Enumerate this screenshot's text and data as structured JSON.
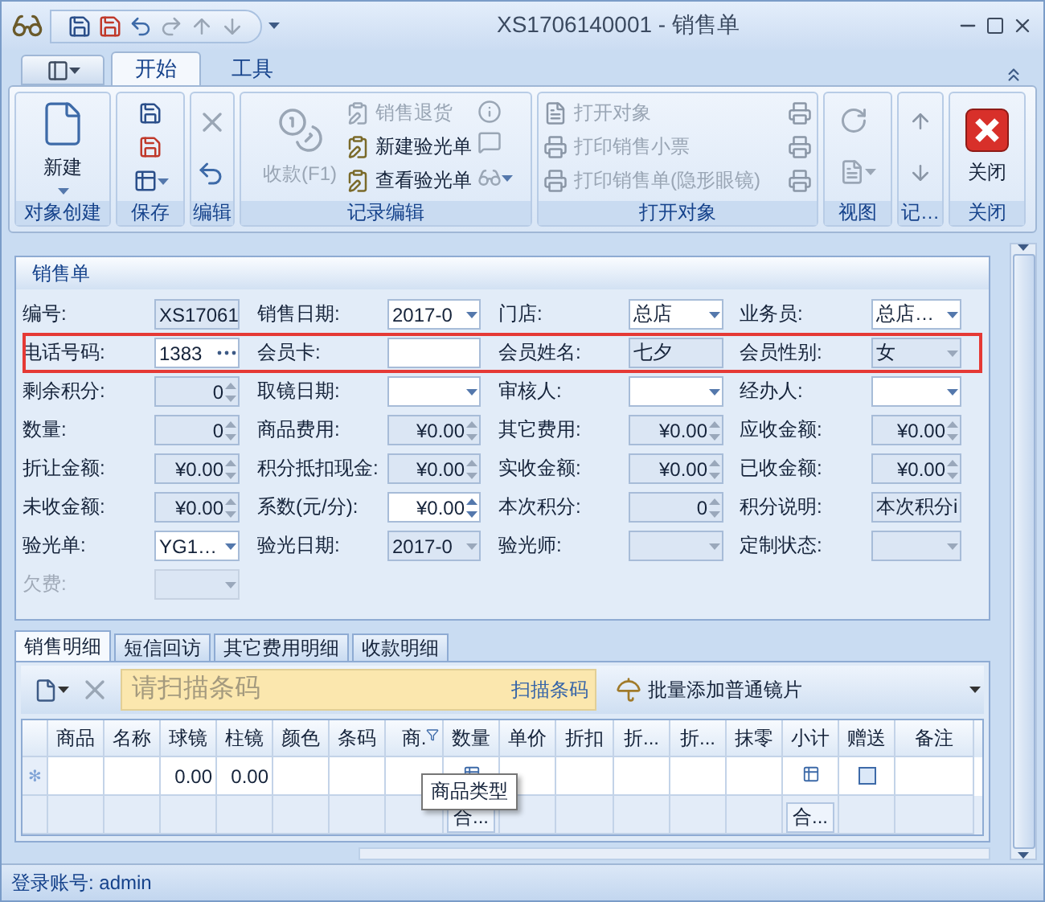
{
  "window": {
    "title": "XS1706140001 - 销售单"
  },
  "ribbon": {
    "tabs": [
      {
        "label": "开始",
        "selected": true
      },
      {
        "label": "工具",
        "selected": false
      }
    ],
    "groups": [
      {
        "title": "对象创建",
        "kind": "new",
        "buttons": [
          {
            "label": "新建",
            "disabled": false
          }
        ]
      },
      {
        "title": "保存",
        "kind": "save"
      },
      {
        "title": "编辑",
        "kind": "edit"
      },
      {
        "title": "记录编辑",
        "kind": "record",
        "buttons": [
          {
            "label": "收款(F1)",
            "disabled": true
          },
          {
            "label": "销售退货",
            "disabled": true
          },
          {
            "label": "新建验光单",
            "disabled": false
          },
          {
            "label": "查看验光单",
            "disabled": false
          }
        ]
      },
      {
        "title": "打开对象",
        "kind": "open",
        "buttons": [
          {
            "label": "打开对象",
            "disabled": true
          },
          {
            "label": "打印销售小票",
            "disabled": true
          },
          {
            "label": "打印销售单(隐形眼镜)",
            "disabled": true
          }
        ]
      },
      {
        "title": "视图",
        "kind": "view"
      },
      {
        "title": "记…",
        "kind": "nav"
      },
      {
        "title": "关闭",
        "kind": "close",
        "buttons": [
          {
            "label": "关闭",
            "disabled": false
          }
        ]
      }
    ]
  },
  "form": {
    "title": "销售单",
    "rows": [
      {
        "highlighted": false,
        "fields": [
          {
            "label": "编号:",
            "value": "XS17061",
            "kind": "text",
            "editable": false,
            "disabled": false
          },
          {
            "label": "销售日期:",
            "value": "2017-0",
            "kind": "combo",
            "editable": true,
            "disabled": false
          },
          {
            "label": "门店:",
            "value": "总店",
            "kind": "combo",
            "editable": true,
            "disabled": false
          },
          {
            "label": "业务员:",
            "value": "总店…",
            "kind": "combo",
            "editable": true,
            "disabled": false
          }
        ]
      },
      {
        "highlighted": true,
        "fields": [
          {
            "label": "电话号码:",
            "value": "1383",
            "kind": "ellipsis",
            "editable": true,
            "disabled": false
          },
          {
            "label": "会员卡:",
            "kind": "text",
            "editable": true,
            "disabled": false
          },
          {
            "label": "会员姓名:",
            "value": "七夕",
            "kind": "text",
            "editable": false,
            "disabled": false
          },
          {
            "label": "会员性别:",
            "value": "女",
            "kind": "combo",
            "editable": false,
            "disabled": false
          }
        ]
      },
      {
        "highlighted": false,
        "fields": [
          {
            "label": "剩余积分:",
            "value": "0",
            "kind": "spin",
            "editable": false,
            "disabled": false
          },
          {
            "label": "取镜日期:",
            "kind": "combo",
            "editable": true,
            "disabled": false
          },
          {
            "label": "审核人:",
            "kind": "combo",
            "editable": true,
            "disabled": false
          },
          {
            "label": "经办人:",
            "kind": "combo",
            "editable": true,
            "disabled": false
          }
        ]
      },
      {
        "highlighted": false,
        "fields": [
          {
            "label": "数量:",
            "value": "0",
            "kind": "spin",
            "editable": false,
            "disabled": false
          },
          {
            "label": "商品费用:",
            "value": "¥0.00",
            "kind": "spin",
            "editable": false,
            "disabled": false
          },
          {
            "label": "其它费用:",
            "value": "¥0.00",
            "kind": "spin",
            "editable": false,
            "disabled": false
          },
          {
            "label": "应收金额:",
            "value": "¥0.00",
            "kind": "spin",
            "editable": false,
            "disabled": false
          }
        ]
      },
      {
        "highlighted": false,
        "fields": [
          {
            "label": "折让金额:",
            "value": "¥0.00",
            "kind": "spin",
            "editable": false,
            "disabled": false
          },
          {
            "label": "积分抵扣现金:",
            "value": "¥0.00",
            "kind": "spin",
            "editable": false,
            "disabled": false
          },
          {
            "label": "实收金额:",
            "value": "¥0.00",
            "kind": "spin",
            "editable": false,
            "disabled": false
          },
          {
            "label": "已收金额:",
            "value": "¥0.00",
            "kind": "spin",
            "editable": false,
            "disabled": false
          }
        ]
      },
      {
        "highlighted": false,
        "fields": [
          {
            "label": "未收金额:",
            "value": "¥0.00",
            "kind": "spin",
            "editable": false,
            "disabled": false
          },
          {
            "label": "系数(元/分):",
            "value": "¥0.00",
            "kind": "spin",
            "editable": true,
            "disabled": false
          },
          {
            "label": "本次积分:",
            "value": "0",
            "kind": "spin",
            "editable": false,
            "disabled": false
          },
          {
            "label": "积分说明:",
            "value": "本次积分i",
            "kind": "text",
            "editable": false,
            "disabled": false
          }
        ]
      },
      {
        "highlighted": false,
        "fields": [
          {
            "label": "验光单:",
            "value": "YG1…",
            "kind": "combo",
            "editable": true,
            "disabled": false
          },
          {
            "label": "验光日期:",
            "value": "2017-0",
            "kind": "combo",
            "editable": false,
            "disabled": false
          },
          {
            "label": "验光师:",
            "kind": "combo",
            "editable": false,
            "disabled": false
          },
          {
            "label": "定制状态:",
            "kind": "combo",
            "editable": false,
            "disabled": false
          }
        ]
      },
      {
        "highlighted": false,
        "fields": [
          {
            "label": "欠费:",
            "kind": "combo",
            "editable": false,
            "disabled": true
          }
        ]
      }
    ]
  },
  "detail": {
    "tabs": [
      {
        "label": "销售明细",
        "selected": true
      },
      {
        "label": "短信回访",
        "selected": false
      },
      {
        "label": "其它费用明细",
        "selected": false
      },
      {
        "label": "收款明细",
        "selected": false
      }
    ],
    "scan": {
      "placeholder": "请扫描条码",
      "label": "扫描条码"
    },
    "batch_button": "批量添加普通镜片",
    "columns": [
      {
        "label": "商品"
      },
      {
        "label": "名称"
      },
      {
        "label": "球镜",
        "new_row_value": "0.00"
      },
      {
        "label": "柱镜",
        "new_row_value": "0.00"
      },
      {
        "label": "颜色"
      },
      {
        "label": "条码"
      },
      {
        "label": "商.",
        "filter": true
      },
      {
        "label": "数量",
        "footer": "合..."
      },
      {
        "label": "单价"
      },
      {
        "label": "折扣"
      },
      {
        "label": "折..."
      },
      {
        "label": "折..."
      },
      {
        "label": "抹零"
      },
      {
        "label": "小计",
        "footer": "合..."
      },
      {
        "label": "赠送",
        "new_row_checkbox": false
      },
      {
        "label": "备注"
      }
    ],
    "new_row_marker": "✻",
    "tooltip": "商品类型"
  },
  "status_bar": {
    "text": "登录账号: admin"
  }
}
